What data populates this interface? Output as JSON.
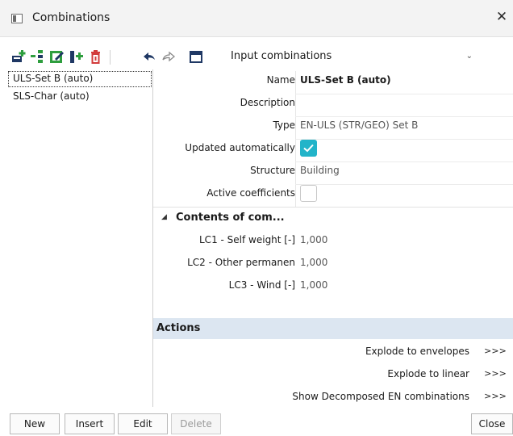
{
  "window": {
    "title": "Combinations",
    "close_symbol": "✕"
  },
  "toolbar": {
    "icons": [
      "new-icon",
      "insert-icon",
      "edit-icon",
      "copy-icon",
      "delete-icon",
      "undo-icon",
      "redo-icon",
      "window-icon"
    ],
    "combo_value": "Input combinations",
    "combo_arrow": "⌄"
  },
  "list": {
    "items": [
      {
        "label": "ULS-Set B (auto)",
        "selected": true
      },
      {
        "label": "SLS-Char (auto)",
        "selected": false
      }
    ]
  },
  "properties": {
    "name": {
      "label": "Name",
      "value": "ULS-Set B (auto)"
    },
    "description": {
      "label": "Description",
      "value": ""
    },
    "type": {
      "label": "Type",
      "value": "EN-ULS (STR/GEO) Set B"
    },
    "updated": {
      "label": "Updated automatically",
      "checked": true
    },
    "structure": {
      "label": "Structure",
      "value": "Building"
    },
    "active": {
      "label": "Active coefficients",
      "checked": false
    }
  },
  "contents": {
    "title": "Contents of com...",
    "arrow": "◢",
    "rows": [
      {
        "label": "LC1 - Self weight [-]",
        "value": "1,000"
      },
      {
        "label": "LC2 - Other permanen",
        "value": "1,000"
      },
      {
        "label": "LC3 - Wind [-]",
        "value": "1,000"
      }
    ]
  },
  "actions": {
    "title": "Actions",
    "rows": [
      {
        "label": "Explode to envelopes",
        "button": ">>>"
      },
      {
        "label": "Explode to linear",
        "button": ">>>"
      },
      {
        "label": "Show Decomposed EN combinations",
        "button": ">>>"
      }
    ]
  },
  "buttons": {
    "new": "New",
    "insert": "Insert",
    "edit": "Edit",
    "delete": "Delete",
    "close": "Close"
  },
  "colors": {
    "accent": "#22b4c9",
    "actions_bg": "#dce6f1",
    "icon_green": "#2e9e3e",
    "icon_red": "#d23b3b",
    "icon_navy": "#1f3864"
  }
}
